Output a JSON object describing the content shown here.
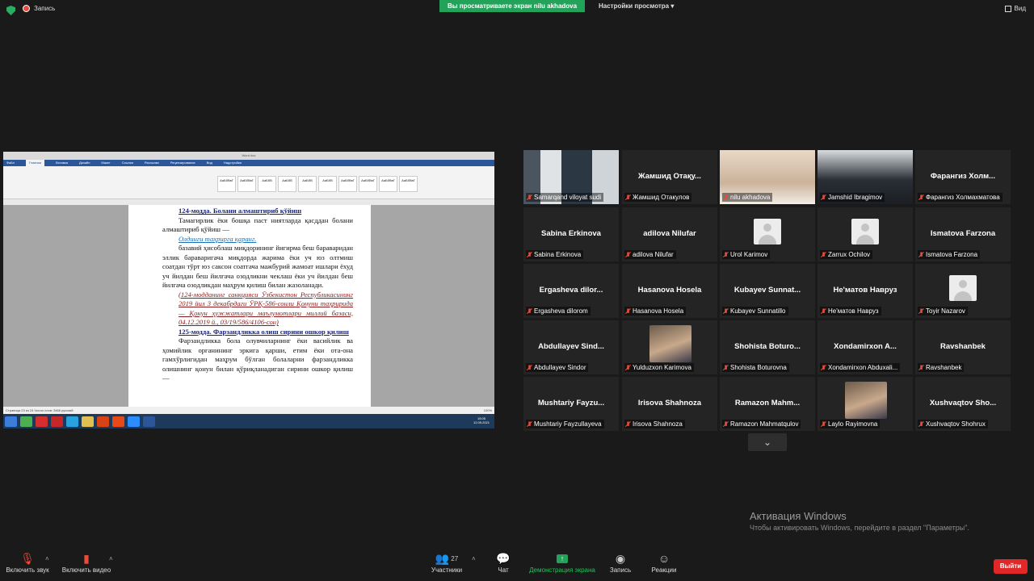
{
  "top": {
    "recording_label": "Запись",
    "viewing_banner": "Вы просматриваете экран nilu akhadova",
    "view_options": "Настройки просмотра",
    "view_button": "Вид"
  },
  "shared_screen": {
    "window_title": "Word doc",
    "ribbon_tabs": [
      "Файл",
      "Главная",
      "Вставка",
      "Дизайн",
      "Макет",
      "Ссылки",
      "Рассылки",
      "Рецензирование",
      "Вид",
      "Надстройки"
    ],
    "styles": [
      "АаБбВвГ",
      "АаБбВвГ",
      "АаБбВ",
      "АаБбВ",
      "АаБбВ",
      "АаБбВ",
      "АаБбВвГ",
      "АаБбВвГ",
      "АаБбВвГ",
      "АаБбВвГ"
    ],
    "doc": {
      "art124_title": "124-модда. Болани алмаштириб қўйиш",
      "art124_p1": "Тамагирлик ёки бошқа паст ниятларда қасддан болани алмаштириб қўйиш —",
      "art124_link": "Олдинги таҳрирга қаранг.",
      "art124_p2": "базавий ҳисоблаш миқдорининг йигирма беш бараваридан эллик бараваригача миқдорда жарима ёки уч юз олтмиш соатдан тўрт юз саксон соатгача мажбурий жамоат ишлари ёхуд уч йилдан беш йилгача озодликни чеклаш ёки уч йилдан беш йилгача озодликдан маҳрум қилиш билан жазоланади.",
      "art124_note": "(124-модданинг санкцияси Ўзбекистон Республикасининг 2019 йил 3 декабрдаги ЎРҚ-586-сонли Қонуни таҳририда — Қонун ҳужжатлари маълумотлари миллий базаси, 04.12.2019 й., 03/19/586/4106-сон)",
      "art125_title": "125-модда. Фарзандликка олиш сирини ошкор қилиш",
      "art125_p1": "Фарзандликка бола олувчиларнинг ёки васийлик ва ҳомийлик органининг эркига қарши, етим ёки ота-она гамхўрлигидан маҳрум бўлган болаларни фарзандликка олишнинг қонун билан қўриқланадиган сирини ошкор қилиш —"
    },
    "status_bar": "Страница 23 из 24   Число слов: 3466   русский",
    "clock_time": "15:05",
    "clock_date": "12.05.2021",
    "zoom": "100%"
  },
  "gallery": [
    {
      "name": "",
      "label": "Samarqand viloyat sudi",
      "kind": "video",
      "active": true
    },
    {
      "name": "Жамшид Отақу...",
      "label": "Жамшид Отакулов",
      "kind": "name"
    },
    {
      "name": "",
      "label": "nilu akhadova",
      "kind": "video"
    },
    {
      "name": "",
      "label": "Jamshid Ibragimov",
      "kind": "video"
    },
    {
      "name": "Фарангиз Холм...",
      "label": "Фарангиз Холмахматова",
      "kind": "name"
    },
    {
      "name": "Sabina Erkinova",
      "label": "Sabina Erkinova",
      "kind": "name"
    },
    {
      "name": "adilova Nilufar",
      "label": "adilova Nilufar",
      "kind": "name"
    },
    {
      "name": "",
      "label": "Urol Karimov",
      "kind": "avatar"
    },
    {
      "name": "",
      "label": "Zarrux Ochilov",
      "kind": "avatar"
    },
    {
      "name": "Ismatova Farzona",
      "label": "Ismatova Farzona",
      "kind": "name"
    },
    {
      "name": "Ergasheva dilor...",
      "label": "Ergasheva dilorom",
      "kind": "name"
    },
    {
      "name": "Hasanova Hosela",
      "label": "Hasanova Hosela",
      "kind": "name"
    },
    {
      "name": "Kubayev Sunnat...",
      "label": "Kubayev Sunnatillo",
      "kind": "name"
    },
    {
      "name": "Не'матов Навруз",
      "label": "Не'матов Навруз",
      "kind": "name"
    },
    {
      "name": "",
      "label": "Toyir Nazarov",
      "kind": "avatar"
    },
    {
      "name": "Abdullayev Sind...",
      "label": "Abdullayev Sindor",
      "kind": "name"
    },
    {
      "name": "",
      "label": "Yulduzxon Karimova",
      "kind": "photo"
    },
    {
      "name": "Shohista Boturo...",
      "label": "Shohista Boturovna",
      "kind": "name"
    },
    {
      "name": "Xondamirxon A...",
      "label": "Xondamirxon Abduxali...",
      "kind": "name"
    },
    {
      "name": "Ravshanbek",
      "label": "Ravshanbek",
      "kind": "name"
    },
    {
      "name": "Mushtariy Fayzu...",
      "label": "Mushtariy Fayzullayeva",
      "kind": "name"
    },
    {
      "name": "Irisova Shahnoza",
      "label": "Irisova Shahnoza",
      "kind": "name"
    },
    {
      "name": "Ramazon Mahm...",
      "label": "Ramazon Mahmatqulov",
      "kind": "name"
    },
    {
      "name": "",
      "label": "Laylo Rayimovna",
      "kind": "photo"
    },
    {
      "name": "Xushvaqtov Sho...",
      "label": "Xushvaqtov Shohrux",
      "kind": "name"
    }
  ],
  "activation": {
    "title": "Активация Windows",
    "text": "Чтобы активировать Windows, перейдите в раздел \"Параметры\"."
  },
  "toolbar": {
    "unmute": "Включить звук",
    "start_video": "Включить видео",
    "participants": "Участники",
    "participants_count": "27",
    "chat": "Чат",
    "share_screen": "Демонстрация экрана",
    "record": "Запись",
    "reactions": "Реакции",
    "leave": "Выйти"
  },
  "colors": {
    "accent_green": "#23a35a",
    "leave_red": "#e02828",
    "active_speaker": "#b6e022"
  }
}
